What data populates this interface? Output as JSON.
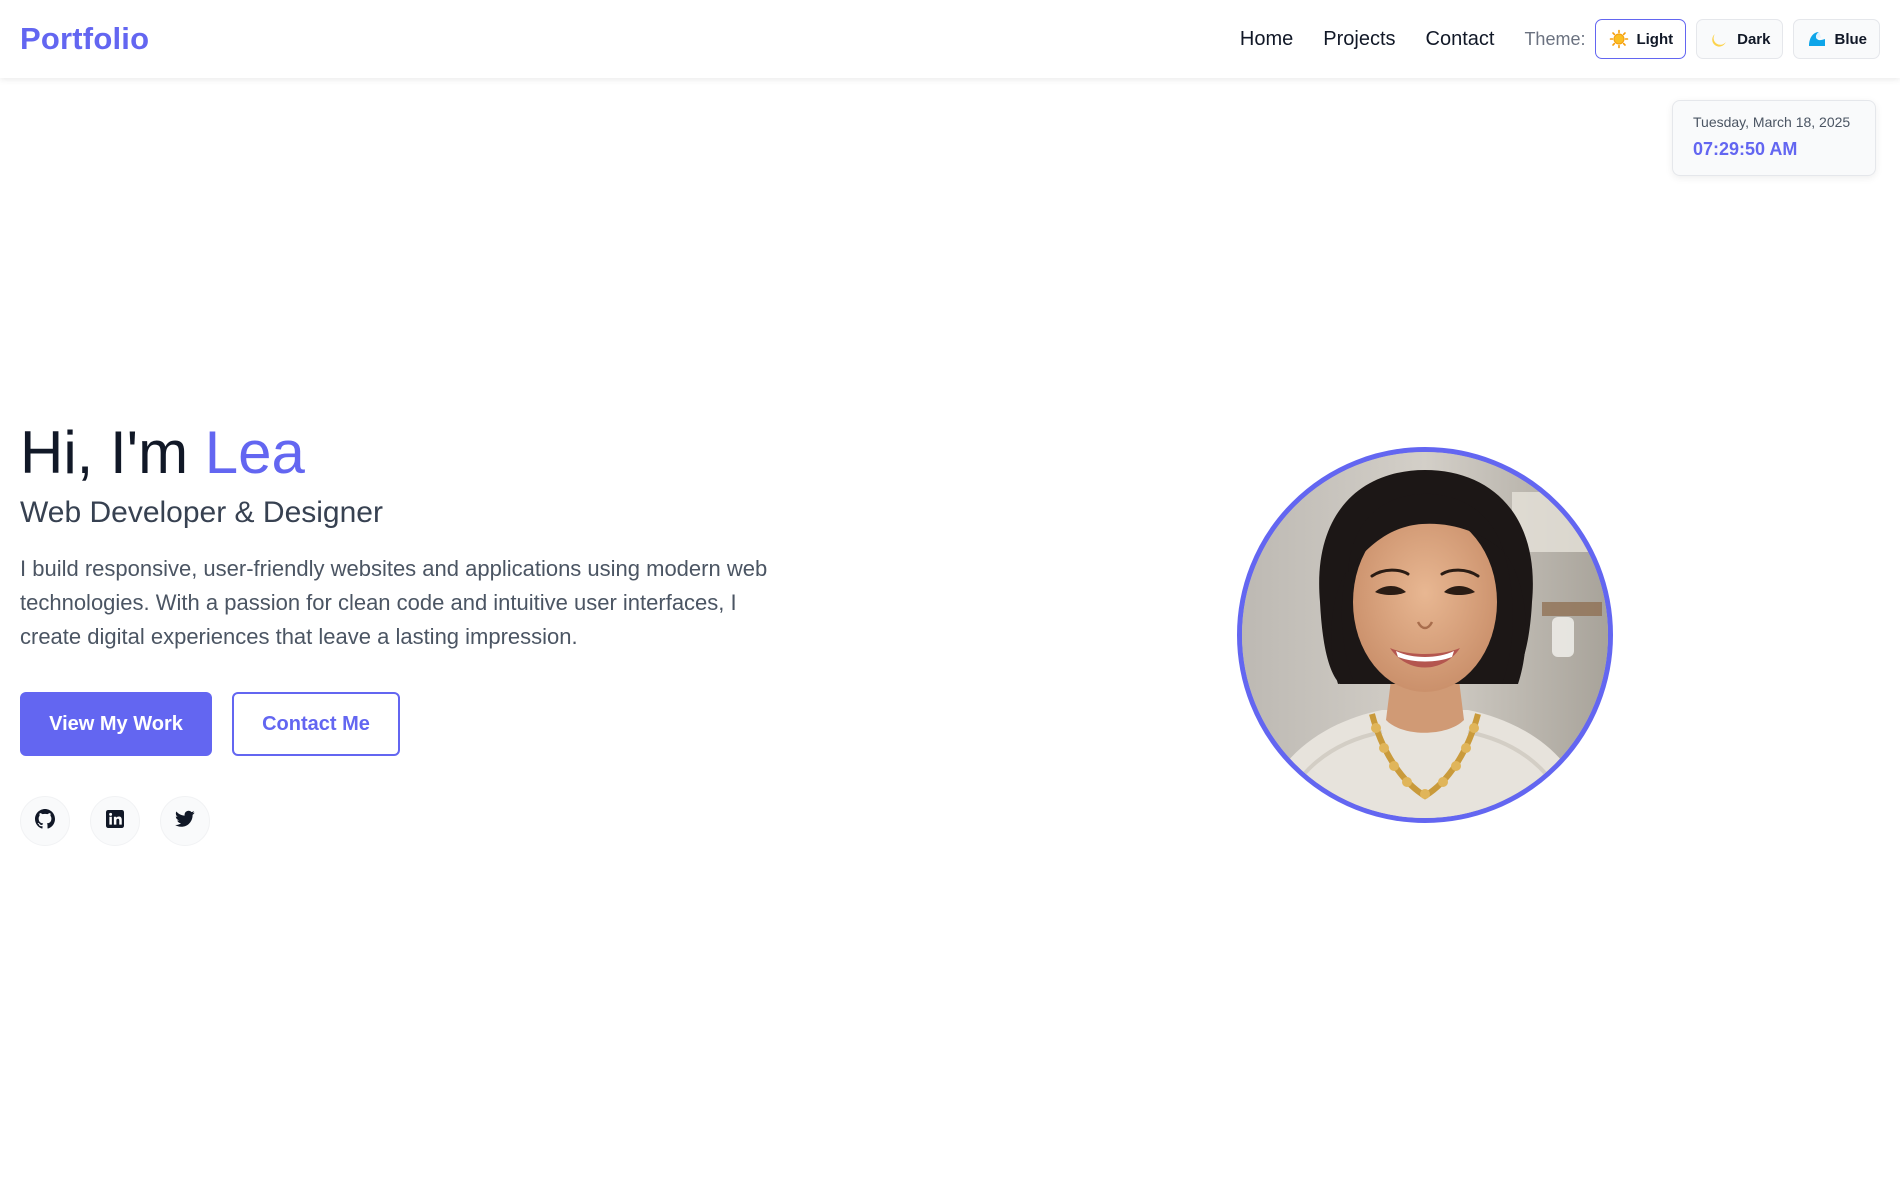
{
  "header": {
    "logo": "Portfolio",
    "nav": [
      "Home",
      "Projects",
      "Contact"
    ],
    "theme_label": "Theme:",
    "themes": [
      {
        "label": "Light",
        "icon": "sun-icon",
        "active": true
      },
      {
        "label": "Dark",
        "icon": "moon-icon",
        "active": false
      },
      {
        "label": "Blue",
        "icon": "wave-icon",
        "active": false
      }
    ]
  },
  "clock": {
    "date": "Tuesday, March 18, 2025",
    "time": "07:29:50 AM"
  },
  "hero": {
    "greeting": "Hi, I'm ",
    "name": "Lea",
    "subtitle": "Web Developer & Designer",
    "description": "I build responsive, user-friendly websites and applications using modern web technologies. With a passion for clean code and intuitive user interfaces, I create digital experiences that leave a lasting impression.",
    "primary_button": "View My Work",
    "secondary_button": "Contact Me",
    "social": [
      "github-icon",
      "linkedin-icon",
      "twitter-icon"
    ]
  },
  "colors": {
    "accent": "#6366f1",
    "text": "#111827",
    "muted": "#4b5563"
  }
}
